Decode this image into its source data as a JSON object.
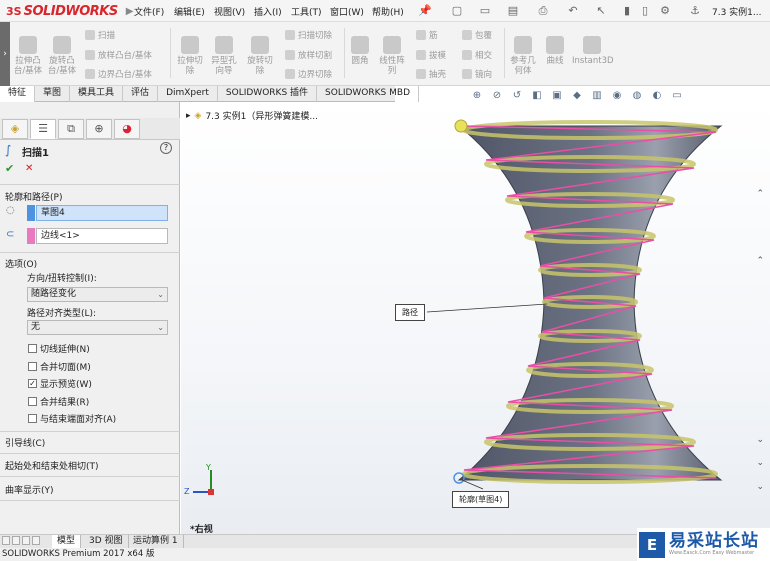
{
  "app": {
    "brand_prefix": "3S",
    "brand_name": "SOLIDWORKS",
    "document_title": "7.3 实例1...",
    "status_text": "SOLIDWORKS Premium 2017 x64 版"
  },
  "menu": [
    "文件(F)",
    "编辑(E)",
    "视图(V)",
    "插入(I)",
    "工具(T)",
    "窗口(W)",
    "帮助(H)"
  ],
  "ribbon": {
    "large_buttons": [
      {
        "label": "拉伸凸\n台/基体"
      },
      {
        "label": "旋转凸\n台/基体"
      },
      {
        "label": "拉伸切\n除"
      },
      {
        "label": "异型孔\n向导"
      },
      {
        "label": "旋转切\n除"
      },
      {
        "label": "圆角"
      },
      {
        "label": "线性阵\n列"
      },
      {
        "label": "参考几\n何体"
      },
      {
        "label": "曲线"
      },
      {
        "label": "Instant3D"
      }
    ],
    "small_buttons": [
      "扫描",
      "放样凸台/基体",
      "边界凸台/基体",
      "扫描切除",
      "放样切割",
      "边界切除",
      "筋",
      "拔模",
      "抽壳",
      "包覆",
      "相交",
      "镜向"
    ]
  },
  "command_tabs": [
    "特征",
    "草图",
    "模具工具",
    "评估",
    "DimXpert",
    "SOLIDWORKS 插件",
    "SOLIDWORKS MBD"
  ],
  "property_manager": {
    "feature_title": "扫描1",
    "ok_symbol": "✔",
    "cancel_symbol": "✕",
    "profile_section": {
      "title": "轮廓和路径(P)",
      "profile_value": "草图4",
      "path_value": "边线<1>"
    },
    "options_section": {
      "title": "选项(O)",
      "orientation_label": "方向/扭转控制(I):",
      "orientation_value": "随路径变化",
      "path_align_label": "路径对齐类型(L):",
      "path_align_value": "无",
      "checkboxes": [
        {
          "label": "切线延伸(N)",
          "checked": false
        },
        {
          "label": "合并切面(M)",
          "checked": false
        },
        {
          "label": "显示预览(W)",
          "checked": true
        },
        {
          "label": "合并结果(R)",
          "checked": false
        },
        {
          "label": "与结束端面对齐(A)",
          "checked": false
        }
      ]
    },
    "collapsed_sections": [
      "引导线(C)",
      "起始处和结束处相切(T)",
      "曲率显示(Y)"
    ]
  },
  "viewport": {
    "tree_item": "7.3 实例1（异形弹簧建模...",
    "path_callout": "路径",
    "profile_callout": "轮廓(草图4)",
    "view_orientation": "*右视",
    "axis_z": "Z",
    "axis_y": "Y"
  },
  "bottom_tabs": [
    "模型",
    "3D 视图",
    "运动算例 1"
  ],
  "watermark": {
    "logo_char": "E",
    "main": "易采站长站",
    "sub": "Www.Easck.Com Easy Webmaster"
  },
  "colors": {
    "brand_red": "#d8262c",
    "body_fill": "#5d6374",
    "spring_pink": "#e84fa7",
    "spring_yellow": "#c8c56a",
    "selection_blue": "#4d93e0",
    "path_pink": "#e97ac1"
  }
}
